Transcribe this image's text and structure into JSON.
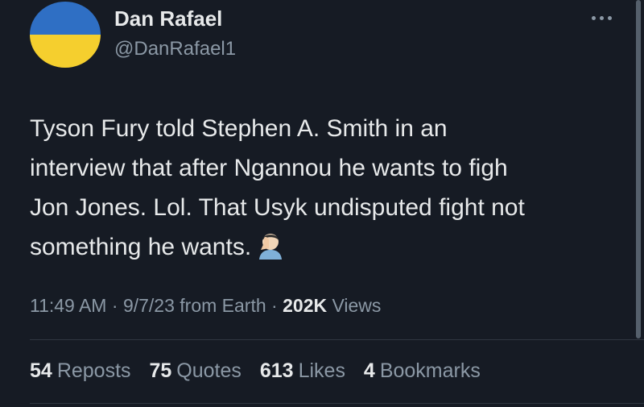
{
  "author": {
    "name": "Dan Rafael",
    "handle": "@DanRafael1",
    "avatar_colors": {
      "top": "#2f6fc4",
      "bottom": "#f5cf2e"
    }
  },
  "more_icon": "ellipsis-icon",
  "tweet": {
    "lines": [
      "Tyson Fury told Stephen A. Smith in an",
      "interview that after Ngannou he wants to figh",
      "Jon Jones. Lol. That Usyk undisputed fight not",
      "something he wants."
    ],
    "emoji": "facepalm-emoji"
  },
  "meta": {
    "time": "11:49 AM",
    "sep1": "·",
    "date": "9/7/23",
    "source": "from Earth",
    "sep2": "·",
    "views_count": "202K",
    "views_label": "Views"
  },
  "stats": {
    "reposts_count": "54",
    "reposts_label": "Reposts",
    "quotes_count": "75",
    "quotes_label": "Quotes",
    "likes_count": "613",
    "likes_label": "Likes",
    "bookmarks_count": "4",
    "bookmarks_label": "Bookmarks"
  },
  "colors": {
    "background": "#161b24",
    "text_primary": "#e7e9ea",
    "text_secondary": "#8b98a5"
  }
}
